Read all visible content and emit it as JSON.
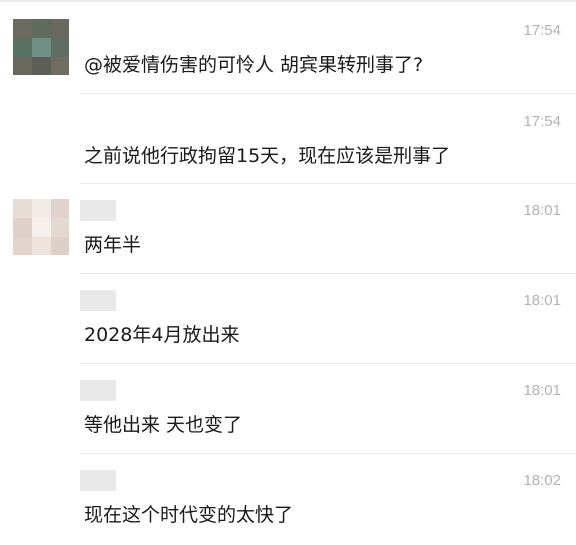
{
  "messages": [
    {
      "time": "17:54",
      "text": "@被爱情伤害的可怜人 胡宾果转刑事了?"
    },
    {
      "time": "17:54",
      "text": "之前说他行政拘留15天，现在应该是刑事了"
    },
    {
      "time": "18:01",
      "text": "两年半"
    },
    {
      "time": "18:01",
      "text": "2028年4月放出来"
    },
    {
      "time": "18:01",
      "text": "等他出来 天也变了"
    },
    {
      "time": "18:02",
      "text": "现在这个时代变的太快了"
    }
  ],
  "colors": {
    "text": "#1a1a1a",
    "time": "#b3b3b3",
    "divider": "#e8e8e8",
    "name_placeholder": "#e9e9e9"
  },
  "icons": {
    "avatar_1": "pixelated-avatar",
    "avatar_2": "pixelated-avatar"
  }
}
